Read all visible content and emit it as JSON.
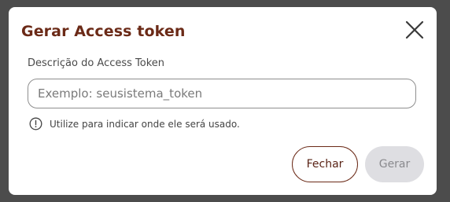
{
  "dialog": {
    "title": "Gerar Access token",
    "close_icon": "close-icon",
    "field": {
      "label": "Descrição do Access Token",
      "value": "",
      "placeholder": "Exemplo: seusistema_token"
    },
    "hint": {
      "icon": "info-circle-icon",
      "text": "Utilize para indicar onde ele será usado."
    },
    "buttons": {
      "close_label": "Fechar",
      "generate_label": "Gerar"
    }
  },
  "colors": {
    "title": "#6b2a17",
    "close_button_border": "#6b2a17",
    "disabled_button_bg": "#dedee2",
    "backdrop": "#4c4c4c"
  }
}
